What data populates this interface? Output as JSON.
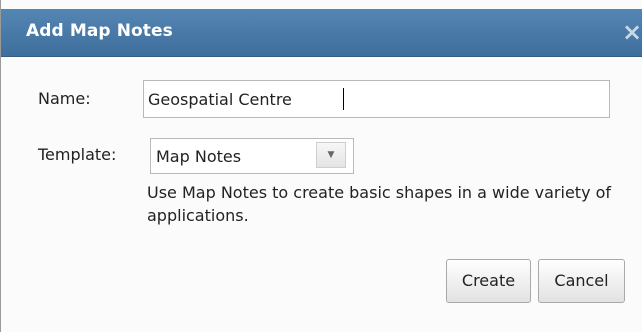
{
  "dialog": {
    "title": "Add Map Notes",
    "close_icon": "×"
  },
  "form": {
    "name_label": "Name:",
    "name_value": "Geospatial Centre",
    "template_label": "Template:",
    "template_selected": "Map Notes",
    "template_arrow_icon": "▼",
    "description": "Use Map Notes to create basic shapes in a wide variety of applications."
  },
  "buttons": {
    "create_label": "Create",
    "cancel_label": "Cancel"
  },
  "colors": {
    "titlebar": "#4a7aa8",
    "title_text": "#ffffff"
  }
}
